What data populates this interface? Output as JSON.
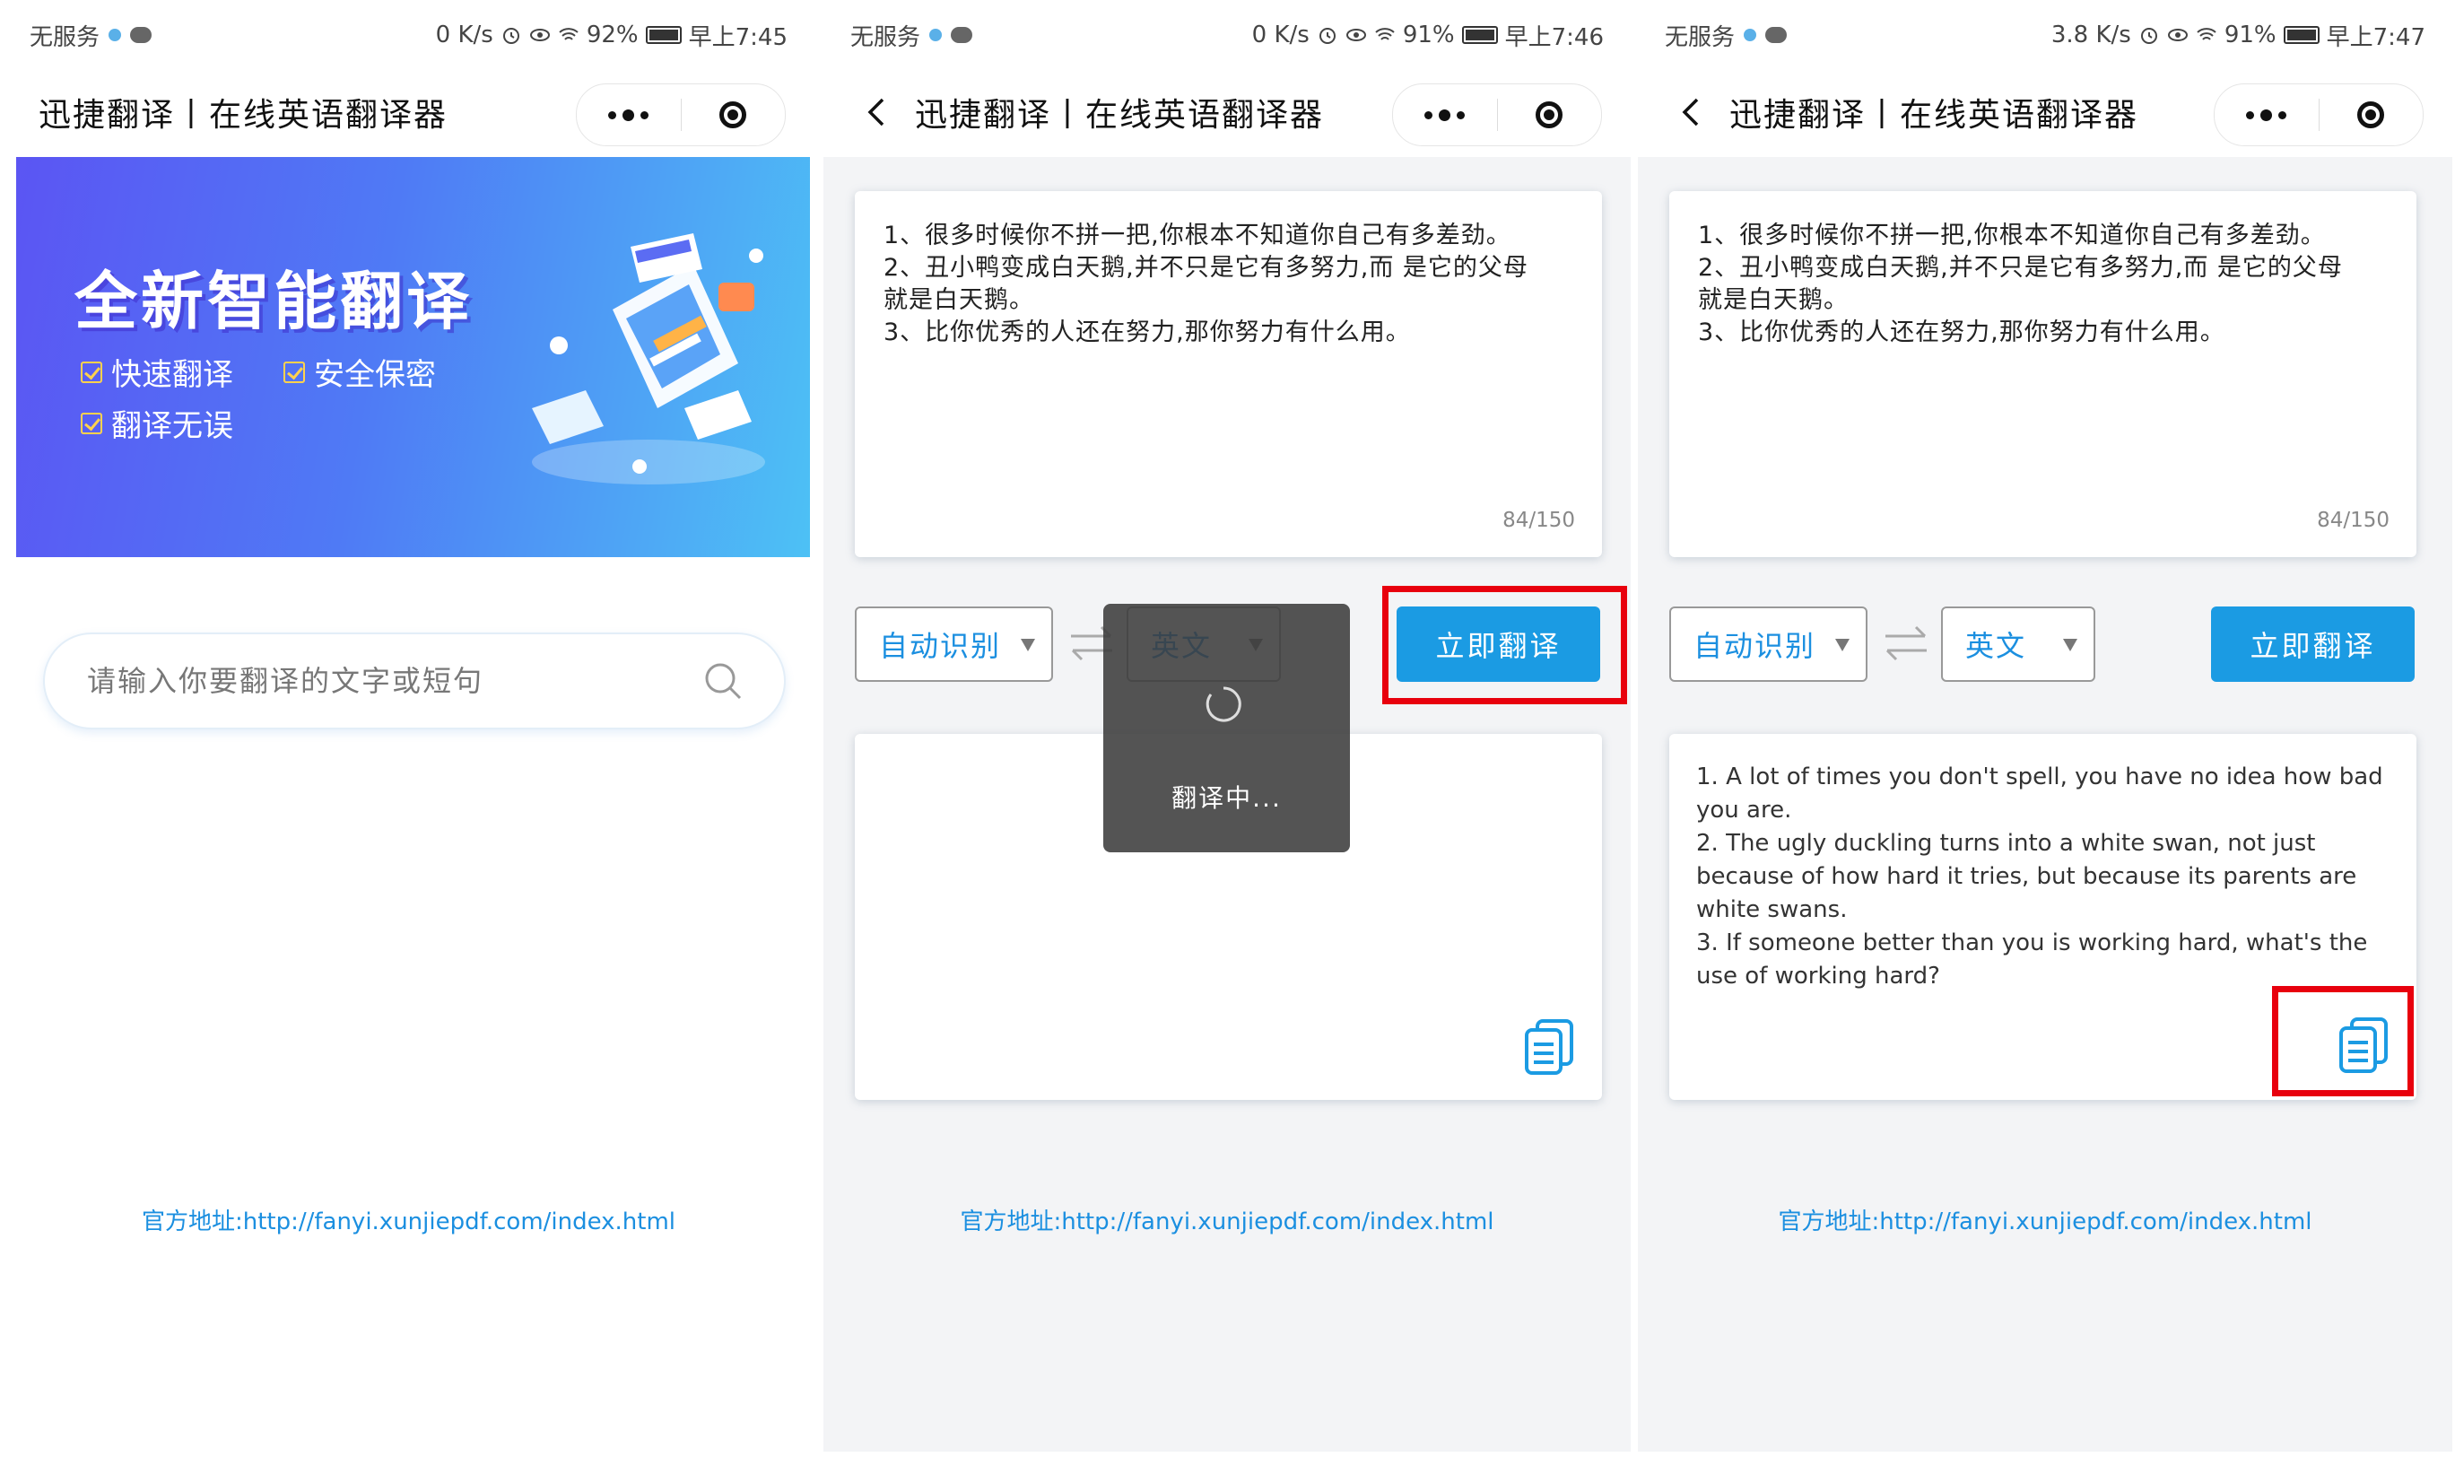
{
  "colors": {
    "accent": "#1b9be3",
    "link": "#1b8fe0",
    "highlight": "#e8000d",
    "banner_start": "#5b55f3",
    "banner_end": "#4dc1f5"
  },
  "panels": [
    {
      "status": {
        "carrier": "无服务",
        "speed": "0 K/s",
        "battery": "92%",
        "time": "早上7:45"
      },
      "nav_title": "迅捷翻译丨在线英语翻译器",
      "banner": {
        "title": "全新智能翻译",
        "features": [
          "快速翻译",
          "安全保密",
          "翻译无误"
        ]
      },
      "search_placeholder": "请输入你要翻译的文字或短句",
      "footer": "官方地址:http://fanyi.xunjiepdf.com/index.html"
    },
    {
      "status": {
        "carrier": "无服务",
        "speed": "0 K/s",
        "battery": "91%",
        "time": "早上7:46"
      },
      "nav_title": "迅捷翻译丨在线英语翻译器",
      "source_text": "1、很多时候你不拼一把,你根本不知道你自己有多差劲。\n2、丑小鸭变成白天鹅,并不只是它有多努力,而 是它的父母\n就是白天鹅。\n3、比你优秀的人还在努力,那你努力有什么用。",
      "char_count": "84/150",
      "from_lang": "自动识别",
      "to_lang": "英文",
      "translate_button": "立即翻译",
      "toast": "翻译中...",
      "footer": "官方地址:http://fanyi.xunjiepdf.com/index.html"
    },
    {
      "status": {
        "carrier": "无服务",
        "speed": "3.8 K/s",
        "battery": "91%",
        "time": "早上7:47"
      },
      "nav_title": "迅捷翻译丨在线英语翻译器",
      "source_text": "1、很多时候你不拼一把,你根本不知道你自己有多差劲。\n2、丑小鸭变成白天鹅,并不只是它有多努力,而 是它的父母\n就是白天鹅。\n3、比你优秀的人还在努力,那你努力有什么用。",
      "char_count": "84/150",
      "from_lang": "自动识别",
      "to_lang": "英文",
      "translate_button": "立即翻译",
      "result_text": "1. A lot of times you don't spell, you have no idea how bad you are.\n2. The ugly duckling turns into a white swan, not just because of how hard it tries, but because its parents are white swans.\n3. If someone better than you is working hard, what's the use of working hard?",
      "footer": "官方地址:http://fanyi.xunjiepdf.com/index.html"
    }
  ]
}
